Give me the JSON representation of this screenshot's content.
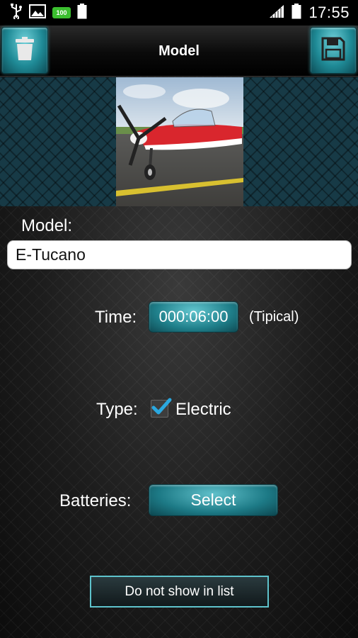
{
  "status_bar": {
    "time": "17:55",
    "battery_badge": "100",
    "battery_small": "100"
  },
  "header": {
    "title": "Model",
    "left_action_icon": "trash-icon",
    "right_action_icon": "save-icon"
  },
  "model": {
    "label": "Model:",
    "name": "E-Tucano"
  },
  "time": {
    "label": "Time:",
    "value": "000:06:00",
    "note": "(Tipical)"
  },
  "type": {
    "label": "Type:",
    "checkbox_label": "Electric",
    "checked": true
  },
  "batteries": {
    "label": "Batteries:",
    "button": "Select"
  },
  "hide_button": "Do not show in list",
  "colors": {
    "accent": "#1f8a96",
    "accent_border": "#5ec3cc",
    "checkmark": "#2aa8e0"
  }
}
